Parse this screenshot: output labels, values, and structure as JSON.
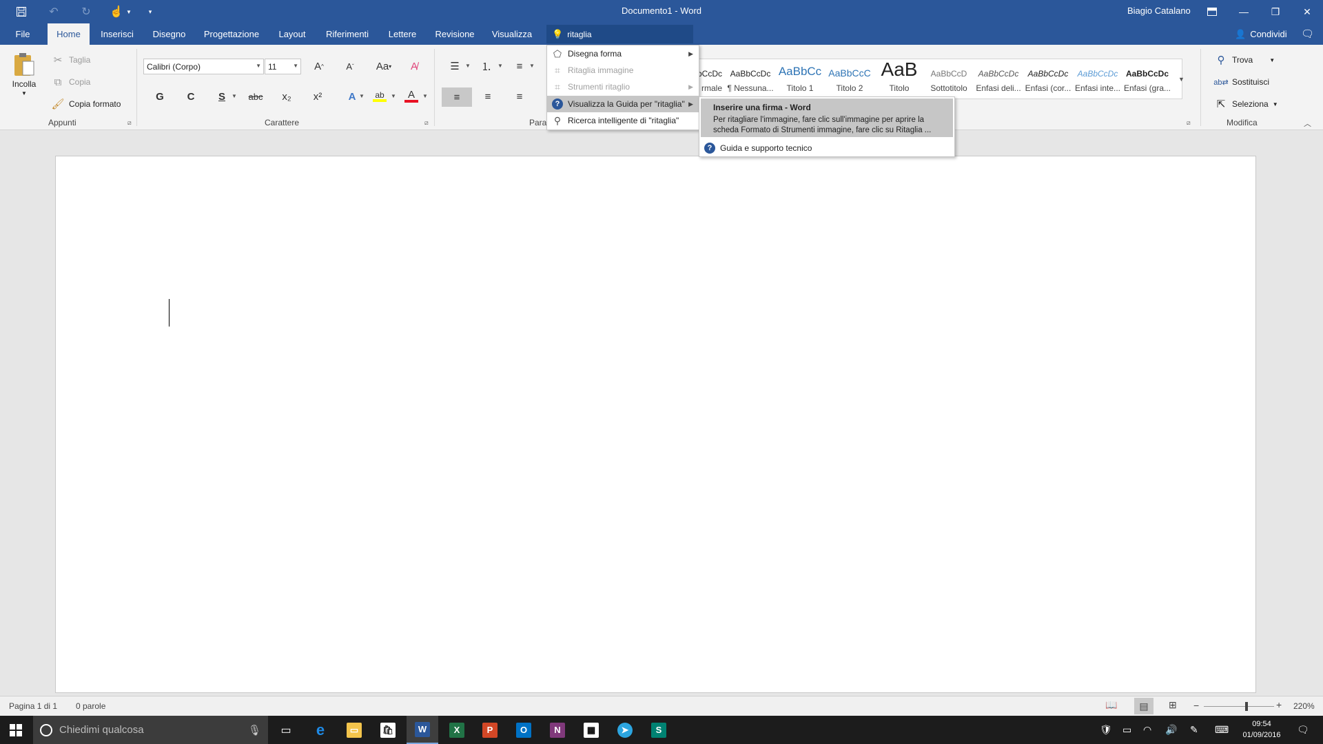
{
  "window": {
    "title": "Documento1  -  Word",
    "user": "Biagio Catalano"
  },
  "qat": {
    "save_icon": "save-icon",
    "undo_icon": "undo-icon",
    "redo_icon": "redo-icon",
    "touch_icon": "touch-mode-icon",
    "customize_icon": "customize-qat-icon"
  },
  "tabs": [
    {
      "label": "File"
    },
    {
      "label": "Home"
    },
    {
      "label": "Inserisci"
    },
    {
      "label": "Disegno"
    },
    {
      "label": "Progettazione"
    },
    {
      "label": "Layout"
    },
    {
      "label": "Riferimenti"
    },
    {
      "label": "Lettere"
    },
    {
      "label": "Revisione"
    },
    {
      "label": "Visualizza"
    }
  ],
  "tellme": {
    "value": "ritaglia"
  },
  "share": {
    "label": "Condividi"
  },
  "clipboard": {
    "paste": "Incolla",
    "cut": "Taglia",
    "copy": "Copia",
    "format_painter": "Copia formato",
    "group": "Appunti"
  },
  "font": {
    "name": "Calibri (Corpo)",
    "size": "11",
    "group": "Carattere",
    "bold": "G",
    "italic": "C",
    "underline": "S",
    "strike": "abc",
    "subscript": "x₂",
    "superscript": "x²"
  },
  "paragraph": {
    "group": "Parag"
  },
  "styles": [
    {
      "sample": "bCcDc",
      "name": "rmale"
    },
    {
      "sample": "AaBbCcDc",
      "name": "¶ Nessuna..."
    },
    {
      "sample": "AaBbCc",
      "name": "Titolo 1"
    },
    {
      "sample": "AaBbCcC",
      "name": "Titolo 2"
    },
    {
      "sample": "AaB",
      "name": "Titolo"
    },
    {
      "sample": "AaBbCcD",
      "name": "Sottotitolo"
    },
    {
      "sample": "AaBbCcDc",
      "name": "Enfasi deli..."
    },
    {
      "sample": "AaBbCcDc",
      "name": "Enfasi (cor..."
    },
    {
      "sample": "AaBbCcDc",
      "name": "Enfasi inte..."
    },
    {
      "sample": "AaBbCcDc",
      "name": "Enfasi (gra..."
    }
  ],
  "editing": {
    "find": "Trova",
    "replace": "Sostituisci",
    "select": "Seleziona",
    "group": "Modifica"
  },
  "tellme_menu": {
    "items": [
      {
        "label": "Disegna forma",
        "icon": "draw-shape-icon",
        "enabled": true
      },
      {
        "label": "Ritaglia immagine",
        "icon": "crop-icon",
        "enabled": false
      },
      {
        "label": "Strumenti ritaglio",
        "icon": "crop-tools-icon",
        "enabled": false
      },
      {
        "label": "Visualizza la Guida per \"ritaglia\"",
        "icon": "help-icon",
        "enabled": true
      },
      {
        "label": "Ricerca intelligente di \"ritaglia\"",
        "icon": "smart-lookup-icon",
        "enabled": true
      }
    ]
  },
  "help_menu": {
    "title": "Inserire una firma - Word",
    "description": "Per ritagliare l'immagine, fare clic sull'immagine per aprire la scheda Formato di Strumenti immagine, fare clic su Ritaglia ...",
    "support": "Guida e supporto tecnico"
  },
  "statusbar": {
    "page": "Pagina 1 di 1",
    "words": "0 parole",
    "zoom": "220%",
    "zoom_minus": "−",
    "zoom_plus": "+"
  },
  "taskbar": {
    "search_placeholder": "Chiedimi qualcosa",
    "time": "09:54",
    "date": "01/09/2016"
  },
  "colors": {
    "accent": "#2b579a",
    "highlight": "#ffff00",
    "font_color": "#e81123"
  }
}
